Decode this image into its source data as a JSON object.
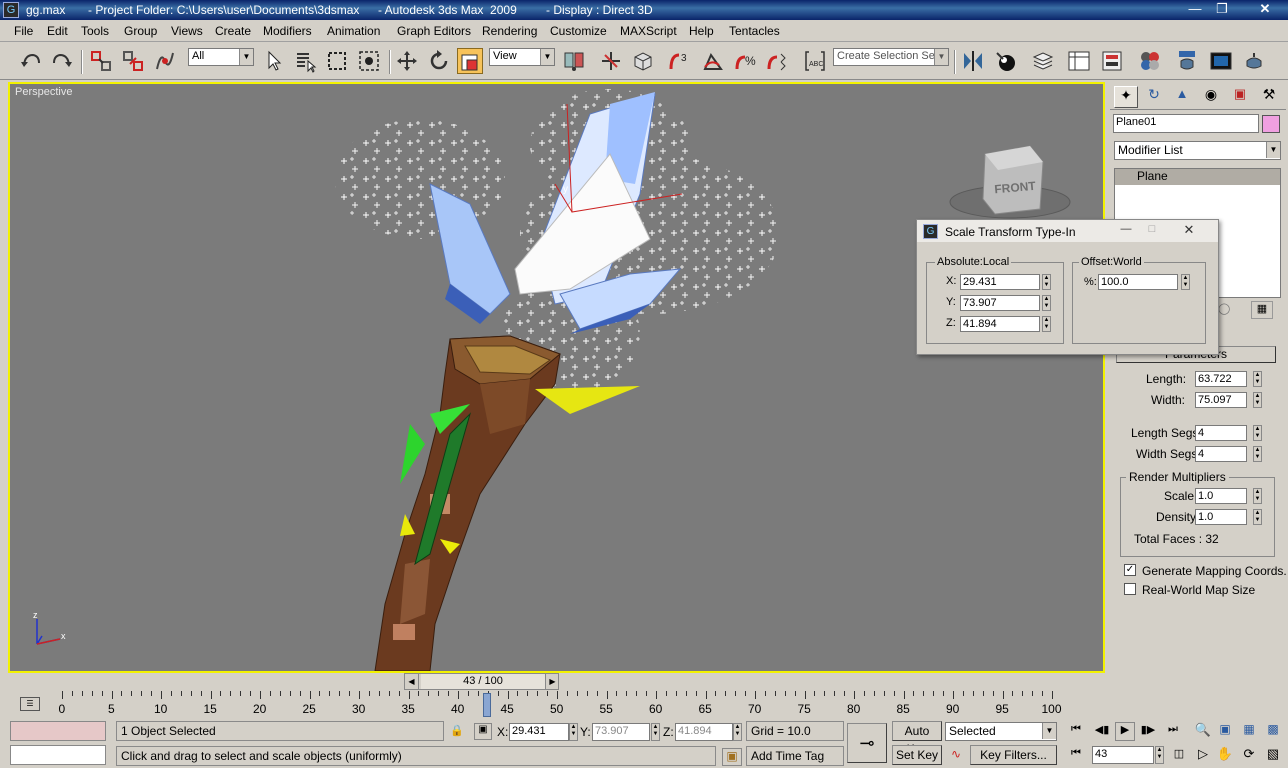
{
  "title": {
    "file": "gg.max",
    "project": "- Project Folder: C:\\Users\\user\\Documents\\3dsmax",
    "app": "- Autodesk 3ds Max  2009",
    "display": "- Display : Direct 3D"
  },
  "menu": [
    "File",
    "Edit",
    "Tools",
    "Group",
    "Views",
    "Create",
    "Modifiers",
    "Animation",
    "Graph Editors",
    "Rendering",
    "Customize",
    "MAXScript",
    "Help",
    "Tentacles"
  ],
  "toolbar": {
    "filter_value": "All",
    "refcoord_value": "View",
    "selection_set_placeholder": "Create Selection Set",
    "snap_label": "3"
  },
  "viewport": {
    "label": "Perspective",
    "viewcube_label": "FRONT",
    "axis_z": "z",
    "axis_x": "x",
    "gizmo_y": "y"
  },
  "dialog": {
    "title": "Scale Transform Type-In",
    "absolute_group": "Absolute:Local",
    "offset_group": "Offset:World",
    "x_label": "X:",
    "y_label": "Y:",
    "z_label": "Z:",
    "pct_label": "%:",
    "x_value": "29.431",
    "y_value": "73.907",
    "z_value": "41.894",
    "pct_value": "100.0"
  },
  "cmdpanel": {
    "object_name": "Plane01",
    "object_color": "#f0a0e0",
    "modifier_list": "Modifier List",
    "stack_item": "Plane",
    "rollout_title": "Parameters",
    "length_label": "Length:",
    "length_value": "63.722",
    "width_label": "Width:",
    "width_value": "75.097",
    "length_segs_label": "Length Segs:",
    "length_segs_value": "4",
    "width_segs_label": "Width Segs:",
    "width_segs_value": "4",
    "render_group": "Render Multipliers",
    "scale_label": "Scale:",
    "scale_value": "1.0",
    "density_label": "Density:",
    "density_value": "1.0",
    "total_faces": "Total Faces : 32",
    "gen_mapping": "Generate Mapping Coords.",
    "real_world": "Real-World Map Size"
  },
  "timeline": {
    "frame_display": "43 / 100",
    "ticks": [
      "0",
      "5",
      "10",
      "15",
      "20",
      "25",
      "30",
      "35",
      "40",
      "45",
      "50",
      "55",
      "60",
      "65",
      "70",
      "75",
      "80",
      "85",
      "90",
      "95",
      "100"
    ]
  },
  "status": {
    "objects_selected": "1 Object Selected",
    "prompt": "Click and drag to select and scale objects (uniformly)",
    "x_label": "X:",
    "y_label": "Y:",
    "z_label": "Z:",
    "x_value": "29.431",
    "y_value": "73.907",
    "z_value": "41.894",
    "grid": "Grid = 10.0",
    "add_time_tag": "Add Time Tag",
    "auto_key": "Auto Key",
    "set_key": "Set Key",
    "key_mode_value": "Selected",
    "key_filters": "Key Filters...",
    "current_frame": "43"
  },
  "colors": {
    "viewport_bg": "#7b7b7b",
    "active_border": "#f2f200",
    "title_bar": "#0a246a"
  }
}
